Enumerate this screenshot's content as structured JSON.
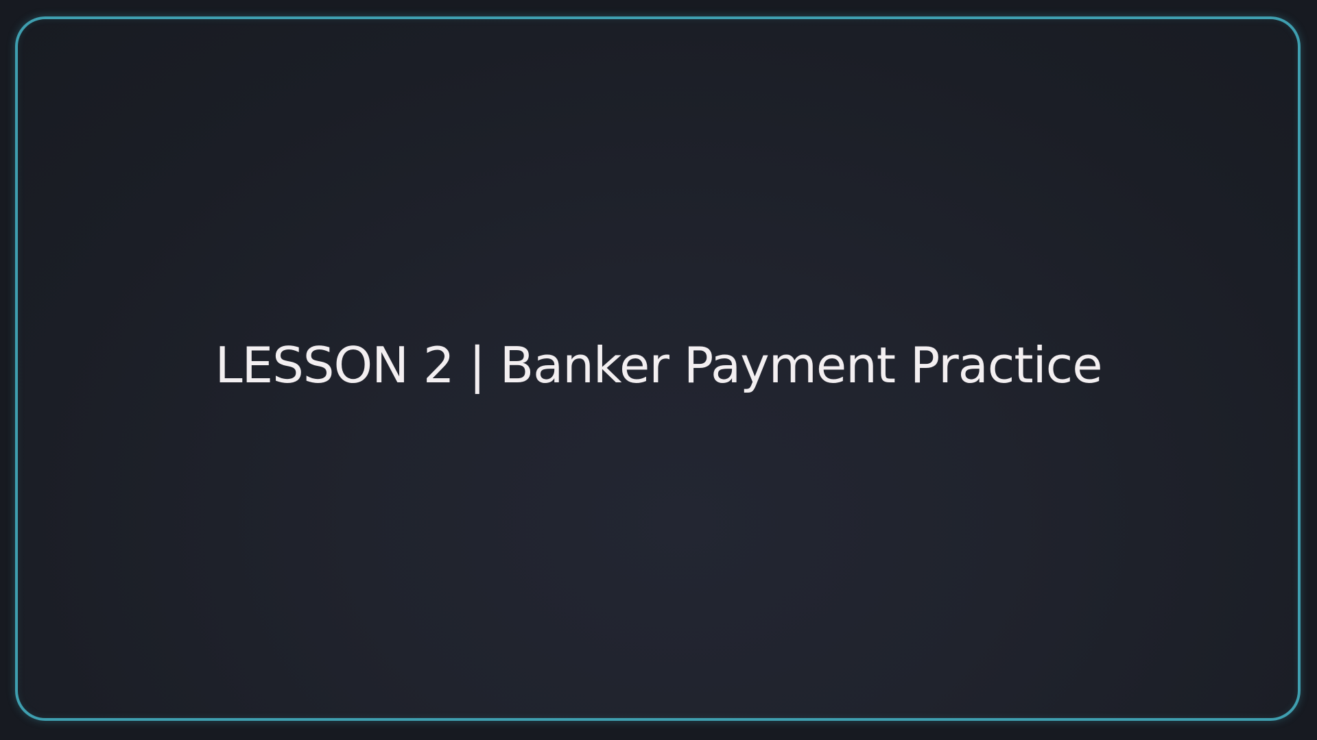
{
  "slide": {
    "title": "LESSON 2 | Banker Payment Practice"
  },
  "colors": {
    "background": "#171a21",
    "frame_border": "#3f9fb0",
    "title_text": "#f3eff1"
  }
}
